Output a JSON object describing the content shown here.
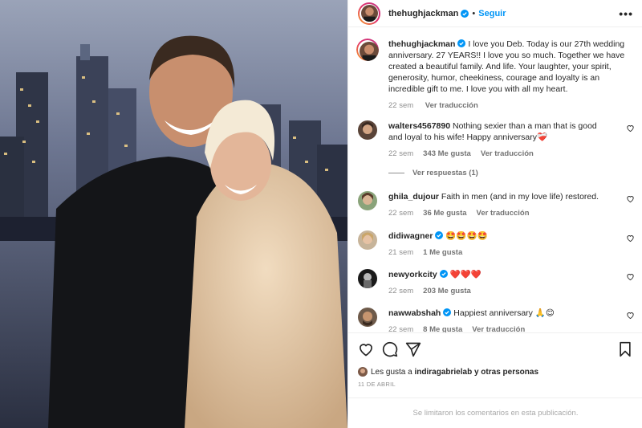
{
  "post": {
    "author": "thehughjackman",
    "follow_label": "Seguir",
    "more_label": "•••",
    "separator": "•"
  },
  "caption": {
    "author": "thehughjackman",
    "text": "I love you Deb. Today is our 27th wedding anniversary. 27 YEARS!! I love you so much. Together we have created a beautiful family. And life. Your laughter, your spirit, generosity, humor, cheekiness, courage and loyalty is an incredible gift to me. I love you with all my heart.",
    "time": "22 sem",
    "translate": "Ver traducción"
  },
  "comments": [
    {
      "user": "walters4567890",
      "text": "Nothing sexier than a man that is good and loyal to his wife! Happy anniversary",
      "emoji": "❤️‍🩹",
      "time": "22 sem",
      "likes": "343 Me gusta",
      "translate": "Ver traducción",
      "replies": "Ver respuestas (1)"
    },
    {
      "user": "ghila_dujour",
      "text": "Faith in men (and in my love life) restored.",
      "time": "22 sem",
      "likes": "36 Me gusta",
      "translate": "Ver traducción"
    },
    {
      "user": "didiwagner",
      "text": "🤩🤩🤩🤩",
      "time": "21 sem",
      "likes": "1 Me gusta"
    },
    {
      "user": "newyorkcity",
      "text": "❤️❤️❤️",
      "time": "22 sem",
      "likes": "203 Me gusta"
    },
    {
      "user": "nawwabshah",
      "text": "Happiest anniversary 🙏😊",
      "time": "22 sem",
      "likes": "8 Me gusta",
      "translate": "Ver traducción"
    }
  ],
  "likes_line": {
    "prefix": "Les gusta a",
    "user": "indiragabrielab",
    "suffix": "y otras personas"
  },
  "date": "11 DE ABRIL",
  "comments_limited": "Se limitaron los comentarios en esta publicación.",
  "icons": {
    "like": "heart-icon",
    "comment": "comment-icon",
    "share": "share-icon",
    "save": "bookmark-icon",
    "verified": "verified-badge-icon",
    "more": "more-options-icon"
  },
  "colors": {
    "accent": "#0095f6",
    "verified": "#0095f6",
    "muted": "#8e8e8e",
    "text": "#262626"
  }
}
